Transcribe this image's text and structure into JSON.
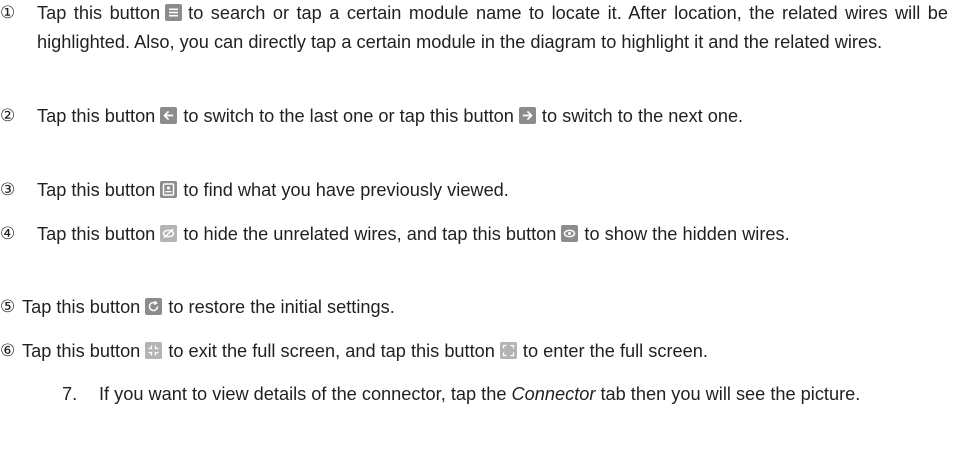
{
  "items": [
    {
      "marker": "①",
      "parts": [
        "Tap this button",
        "to search or tap a certain module name to locate it. After location, the related wires will be highlighted. Also, you can directly tap a certain module in the diagram to highlight it and the related wires."
      ],
      "icons": [
        "list-icon"
      ]
    },
    {
      "marker": "②",
      "parts": [
        "Tap this button",
        "to switch to the last one or tap this button",
        "to switch to the next one."
      ],
      "icons": [
        "arrow-left-icon",
        "arrow-right-icon"
      ]
    },
    {
      "marker": "③",
      "parts": [
        "Tap this button",
        "to find what you have previously viewed."
      ],
      "icons": [
        "history-icon"
      ]
    },
    {
      "marker": "④",
      "parts": [
        "Tap this button",
        "to hide the unrelated wires, and tap this button",
        "to show the hidden wires."
      ],
      "icons": [
        "eye-off-icon",
        "eye-icon"
      ]
    },
    {
      "marker": "⑤",
      "parts": [
        "Tap this button",
        "to restore the initial settings."
      ],
      "icons": [
        "restore-icon"
      ]
    },
    {
      "marker": "⑥",
      "parts": [
        "Tap this button",
        "to exit the full screen, and tap this button",
        "to enter the full screen."
      ],
      "icons": [
        "exit-fullscreen-icon",
        "fullscreen-icon"
      ]
    }
  ],
  "step": {
    "number": "7.",
    "before": "If you want to view details of the connector, tap the ",
    "emph": "Connector",
    "after": " tab then you will see the picture."
  }
}
